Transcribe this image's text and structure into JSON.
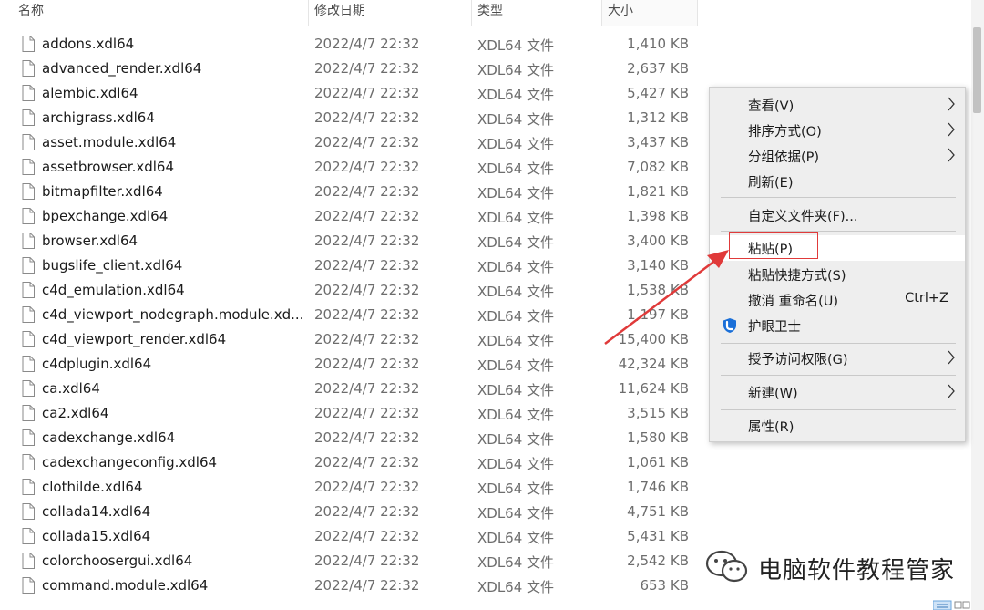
{
  "columns": {
    "name": "名称",
    "modified": "修改日期",
    "type": "类型",
    "size": "大小"
  },
  "files": [
    {
      "name": "addons.xdl64",
      "date": "2022/4/7 22:32",
      "type": "XDL64 文件",
      "size": "1,410 KB"
    },
    {
      "name": "advanced_render.xdl64",
      "date": "2022/4/7 22:32",
      "type": "XDL64 文件",
      "size": "2,637 KB"
    },
    {
      "name": "alembic.xdl64",
      "date": "2022/4/7 22:32",
      "type": "XDL64 文件",
      "size": "5,427 KB"
    },
    {
      "name": "archigrass.xdl64",
      "date": "2022/4/7 22:32",
      "type": "XDL64 文件",
      "size": "1,312 KB"
    },
    {
      "name": "asset.module.xdl64",
      "date": "2022/4/7 22:32",
      "type": "XDL64 文件",
      "size": "3,437 KB"
    },
    {
      "name": "assetbrowser.xdl64",
      "date": "2022/4/7 22:32",
      "type": "XDL64 文件",
      "size": "7,082 KB"
    },
    {
      "name": "bitmapfilter.xdl64",
      "date": "2022/4/7 22:32",
      "type": "XDL64 文件",
      "size": "1,821 KB"
    },
    {
      "name": "bpexchange.xdl64",
      "date": "2022/4/7 22:32",
      "type": "XDL64 文件",
      "size": "1,398 KB"
    },
    {
      "name": "browser.xdl64",
      "date": "2022/4/7 22:32",
      "type": "XDL64 文件",
      "size": "3,400 KB"
    },
    {
      "name": "bugslife_client.xdl64",
      "date": "2022/4/7 22:32",
      "type": "XDL64 文件",
      "size": "3,140 KB"
    },
    {
      "name": "c4d_emulation.xdl64",
      "date": "2022/4/7 22:32",
      "type": "XDL64 文件",
      "size": "1,538 KB"
    },
    {
      "name": "c4d_viewport_nodegraph.module.xd...",
      "date": "2022/4/7 22:32",
      "type": "XDL64 文件",
      "size": "1,197 KB"
    },
    {
      "name": "c4d_viewport_render.xdl64",
      "date": "2022/4/7 22:32",
      "type": "XDL64 文件",
      "size": "15,400 KB"
    },
    {
      "name": "c4dplugin.xdl64",
      "date": "2022/4/7 22:32",
      "type": "XDL64 文件",
      "size": "42,324 KB"
    },
    {
      "name": "ca.xdl64",
      "date": "2022/4/7 22:32",
      "type": "XDL64 文件",
      "size": "11,624 KB"
    },
    {
      "name": "ca2.xdl64",
      "date": "2022/4/7 22:32",
      "type": "XDL64 文件",
      "size": "3,515 KB"
    },
    {
      "name": "cadexchange.xdl64",
      "date": "2022/4/7 22:32",
      "type": "XDL64 文件",
      "size": "1,580 KB"
    },
    {
      "name": "cadexchangeconfig.xdl64",
      "date": "2022/4/7 22:32",
      "type": "XDL64 文件",
      "size": "1,061 KB"
    },
    {
      "name": "clothilde.xdl64",
      "date": "2022/4/7 22:32",
      "type": "XDL64 文件",
      "size": "1,746 KB"
    },
    {
      "name": "collada14.xdl64",
      "date": "2022/4/7 22:32",
      "type": "XDL64 文件",
      "size": "4,751 KB"
    },
    {
      "name": "collada15.xdl64",
      "date": "2022/4/7 22:32",
      "type": "XDL64 文件",
      "size": "5,431 KB"
    },
    {
      "name": "colorchoosergui.xdl64",
      "date": "2022/4/7 22:32",
      "type": "XDL64 文件",
      "size": "2,542 KB"
    },
    {
      "name": "command.module.xdl64",
      "date": "2022/4/7 22:32",
      "type": "XDL64 文件",
      "size": "653 KB"
    }
  ],
  "context_menu": {
    "view": "查看(V)",
    "sort_by": "排序方式(O)",
    "group_by": "分组依据(P)",
    "refresh": "刷新(E)",
    "customize_folder": "自定义文件夹(F)...",
    "paste": "粘贴(P)",
    "paste_shortcut": "粘贴快捷方式(S)",
    "undo_rename": "撤消 重命名(U)",
    "undo_shortcut": "Ctrl+Z",
    "eye_guard": "护眼卫士",
    "give_access": "授予访问权限(G)",
    "new": "新建(W)",
    "properties": "属性(R)"
  },
  "watermark": {
    "text": "电脑软件教程管家",
    "icon": "wechat-icon"
  },
  "colors": {
    "annotation_red": "#e03a3a",
    "menu_bg": "#eeeeee",
    "eye_guard_blue": "#1a6fd8"
  }
}
